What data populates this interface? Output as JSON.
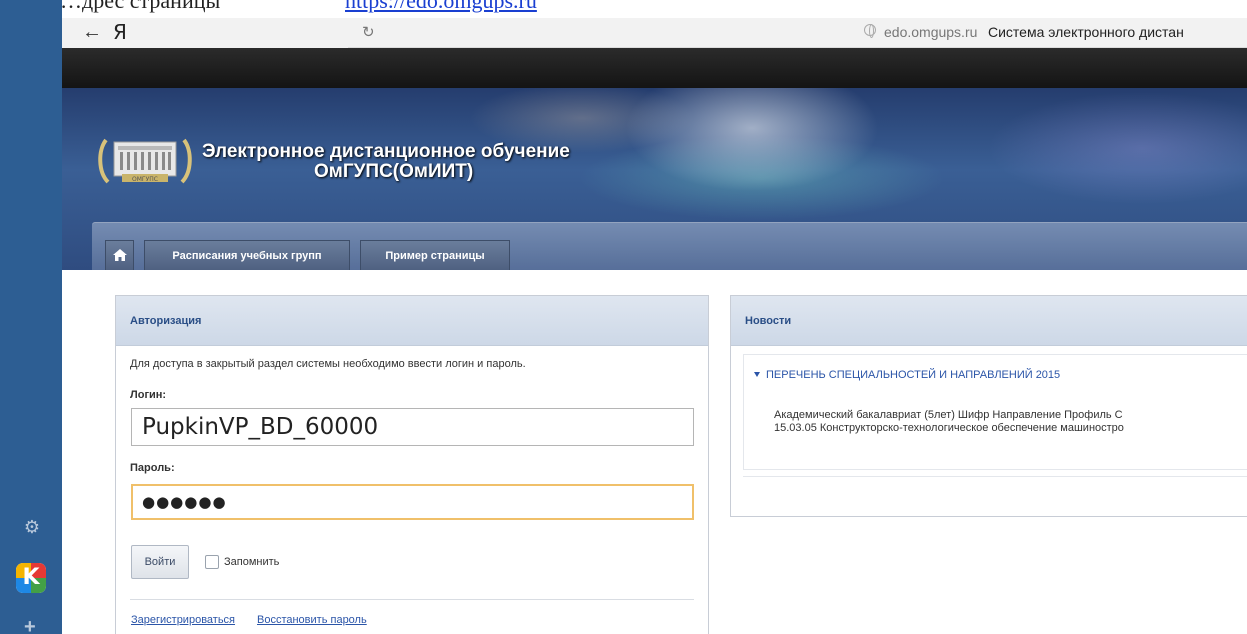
{
  "doc": {
    "prefix": "…дрес страницы",
    "link": "https://edo.omgups.ru"
  },
  "browser": {
    "back_symbol": "←",
    "logo": "Я",
    "reload_symbol": "↻",
    "domain": "edo.omgups.ru",
    "page_title": "Система электронного дистан"
  },
  "sidebar": {
    "gear_symbol": "⚙",
    "app_letter": "K",
    "plus_symbol": "+"
  },
  "header": {
    "title_line1": "Электронное дистанционное обучение",
    "title_line2": "ОмГУПС(ОмИИТ)",
    "logo_caption": "ОМГУПС",
    "tabs": [
      {
        "label": "Расписания учебных групп"
      },
      {
        "label": "Пример страницы"
      }
    ]
  },
  "auth": {
    "heading": "Авторизация",
    "description": "Для доступа в закрытый раздел системы необходимо ввести логин и пароль.",
    "login_label": "Логин:",
    "login_value": "PupkinVP_BD_60000",
    "password_label": "Пароль:",
    "password_value": "●●●●●●",
    "submit_label": "Войти",
    "remember_label": "Запомнить",
    "register_link": "Зарегистрироваться",
    "restore_link": "Восстановить пароль"
  },
  "news": {
    "heading": "Новости",
    "item_title": "ПЕРЕЧЕНЬ СПЕЦИАЛЬНОСТЕЙ И НАПРАВЛЕНИЙ 2015",
    "item_line1": "Академический бакалавриат (5лет)  Шифр  Направление  Профиль  С",
    "item_line2": "15.03.05  Конструкторско-технологическое обеспечение машиностро"
  },
  "colors": {
    "sidebar": "#2d5e93",
    "header_dark": "#1d1d1d",
    "panel_head_text": "#2a4e86",
    "link": "#2b55a8",
    "password_focus": "#f0c06a"
  }
}
